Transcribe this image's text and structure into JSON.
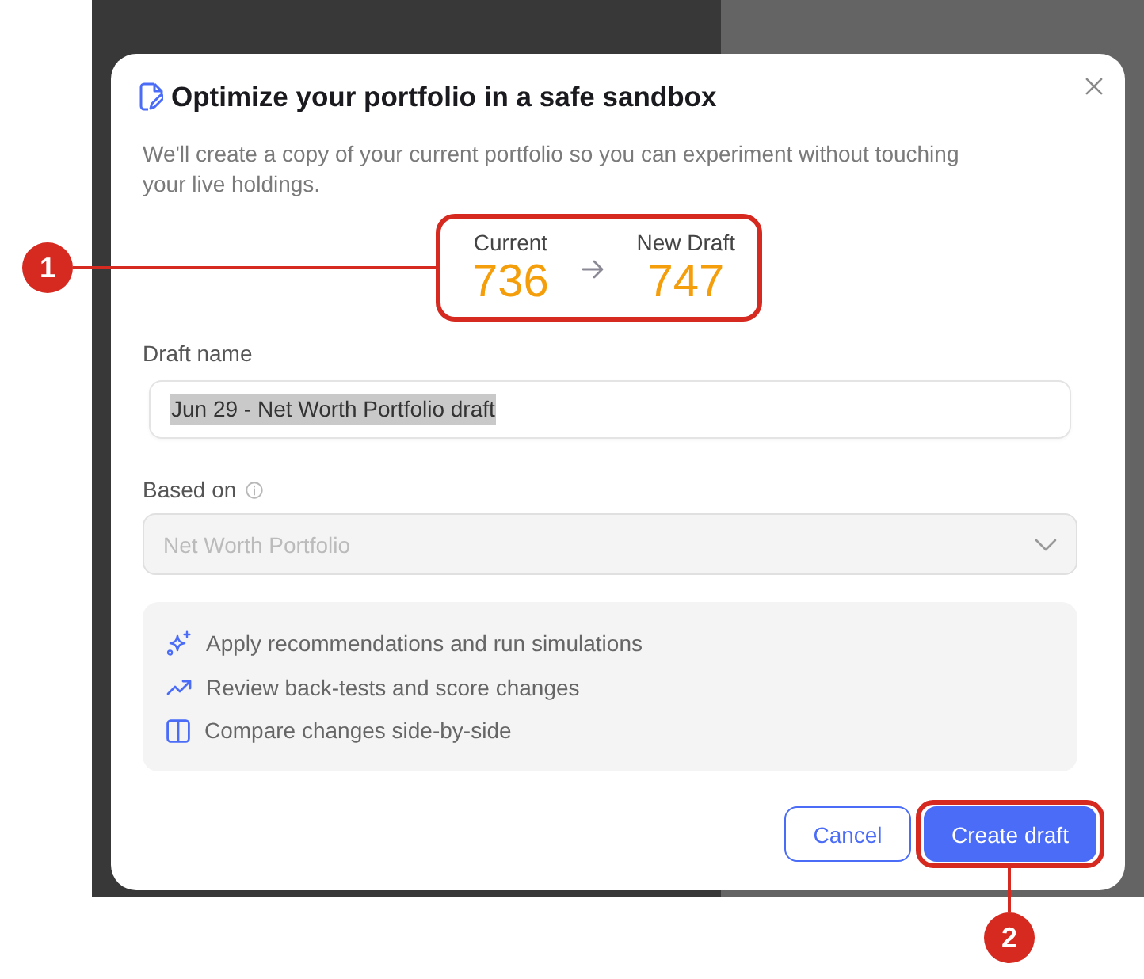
{
  "dialog": {
    "title": "Optimize your portfolio in a safe sandbox",
    "description": "We'll create a copy of your current portfolio so you can experiment without touching your live holdings.",
    "score": {
      "current_label": "Current",
      "current_value": "736",
      "new_label": "New Draft",
      "new_value": "747"
    },
    "draft_name": {
      "label": "Draft name",
      "value": "Jun 29 - Net Worth Portfolio draft",
      "text_selected": true
    },
    "based_on": {
      "label": "Based on",
      "value": "Net Worth Portfolio",
      "disabled": true
    },
    "features": [
      {
        "text": "Apply recommendations and run simulations"
      },
      {
        "text": "Review back-tests and score changes"
      },
      {
        "text": "Compare changes side-by-side"
      }
    ],
    "buttons": [
      {
        "kind": "secondary",
        "label": "Cancel"
      },
      {
        "kind": "primary",
        "label": "Create draft"
      }
    ]
  },
  "annotations": [
    {
      "label": "1"
    },
    {
      "label": "2"
    }
  ]
}
